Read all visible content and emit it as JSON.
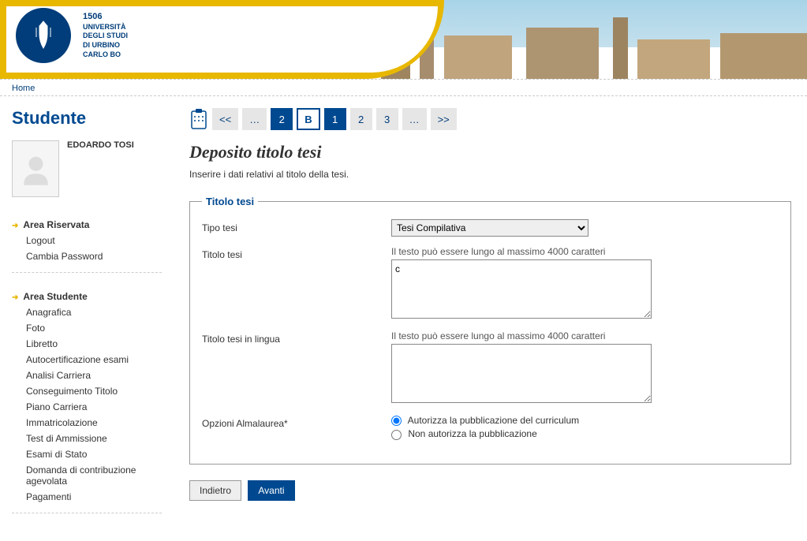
{
  "brand": {
    "year": "1506",
    "line1": "UNIVERSITÀ",
    "line2": "DEGLI STUDI",
    "line3": "DI URBINO",
    "line4": "CARLO BO"
  },
  "nav": {
    "home": "Home"
  },
  "sidebar": {
    "title": "Studente",
    "user_name": "EDOARDO TOSI",
    "area_riservata": {
      "title": "Area Riservata",
      "logout": "Logout",
      "cambia_password": "Cambia Password"
    },
    "area_studente": {
      "title": "Area Studente",
      "items": [
        "Anagrafica",
        "Foto",
        "Libretto",
        "Autocertificazione esami",
        "Analisi Carriera",
        "Conseguimento Titolo",
        "Piano Carriera",
        "Immatricolazione",
        "Test di Ammissione",
        "Esami di Stato",
        "Domanda di contribuzione agevolata",
        "Pagamenti"
      ]
    }
  },
  "wizard": {
    "first": "<<",
    "prev_ell": "…",
    "s1": "2",
    "s2": "B",
    "s3": "1",
    "s4": "2",
    "s5": "3",
    "next_ell": "…",
    "last": ">>"
  },
  "page": {
    "title": "Deposito titolo tesi",
    "desc": "Inserire i dati relativi al titolo della tesi."
  },
  "form": {
    "legend": "Titolo tesi",
    "tipo_tesi_label": "Tipo tesi",
    "tipo_tesi_value": "Tesi Compilativa",
    "titolo_tesi_label": "Titolo tesi",
    "titolo_tesi_hint": "Il testo può essere lungo al massimo 4000 caratteri",
    "titolo_tesi_value": "c",
    "titolo_lingua_label": "Titolo tesi in lingua",
    "titolo_lingua_hint": "Il testo può essere lungo al massimo 4000 caratteri",
    "titolo_lingua_value": "",
    "almalaurea_label": "Opzioni Almalaurea*",
    "almalaurea_opt1": "Autorizza la pubblicazione del curriculum",
    "almalaurea_opt2": "Non autorizza la pubblicazione"
  },
  "buttons": {
    "back": "Indietro",
    "forward": "Avanti"
  }
}
